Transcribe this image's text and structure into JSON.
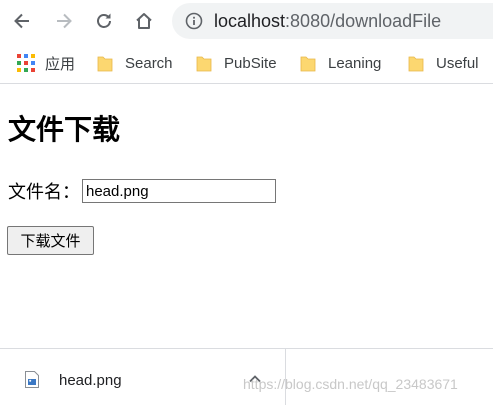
{
  "browser": {
    "url_host": "localhost",
    "url_rest": ":8080/downloadFile",
    "nav_icons": [
      "back-icon",
      "forward-icon",
      "reload-icon",
      "home-icon",
      "info-icon"
    ]
  },
  "bookmarks": [
    {
      "label": "应用",
      "icon": "apps-icon"
    },
    {
      "label": "Search",
      "icon": "folder-icon"
    },
    {
      "label": "PubSite",
      "icon": "folder-icon"
    },
    {
      "label": "Leaning",
      "icon": "folder-icon"
    },
    {
      "label": "Useful",
      "icon": "folder-icon"
    }
  ],
  "page": {
    "title": "文件下载",
    "field_label": "文件名：",
    "field_value": "head.png",
    "button_label": "下载文件"
  },
  "download_shelf": {
    "file_name": "head.png"
  },
  "watermark": "https://blog.csdn.net/qq_23483671",
  "colors": {
    "omnibox_bg": "#f1f3f4",
    "folder": "#fcd770",
    "button_bg": "#efefef"
  }
}
